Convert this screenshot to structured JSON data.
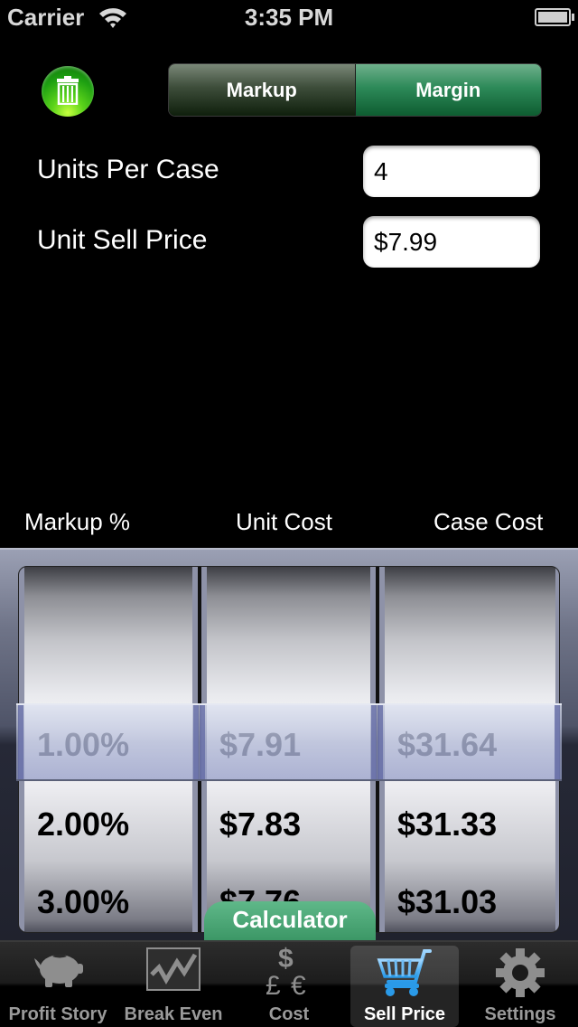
{
  "status_bar": {
    "carrier": "Carrier",
    "time": "3:35 PM",
    "wifi_icon": "wifi-icon",
    "battery_icon": "battery-icon"
  },
  "toolbar": {
    "trash_icon": "trash-icon",
    "trash_color": "#2fb516",
    "segments": [
      {
        "label": "Markup",
        "selected": false
      },
      {
        "label": "Margin",
        "selected": true
      }
    ]
  },
  "form": {
    "units_per_case": {
      "label": "Units Per Case",
      "value": "4"
    },
    "unit_sell_price": {
      "label": "Unit Sell Price",
      "value": "$7.99"
    }
  },
  "picker": {
    "headers": [
      "Markup %",
      "Unit Cost",
      "Case Cost"
    ],
    "columns": [
      {
        "name": "markup",
        "rows": [
          "1.00%",
          "2.00%",
          "3.00%"
        ]
      },
      {
        "name": "unit-cost",
        "rows": [
          "$7.91",
          "$7.83",
          "$7.76"
        ]
      },
      {
        "name": "case-cost",
        "rows": [
          "$31.64",
          "$31.33",
          "$31.03"
        ]
      }
    ],
    "selected_index": 0
  },
  "calculator_tab": {
    "label": "Calculator",
    "color": "#4aa676"
  },
  "tab_bar": {
    "items": [
      {
        "label": "Profit Story",
        "icon": "piggy-bank-icon",
        "active": false
      },
      {
        "label": "Break Even",
        "icon": "chart-line-icon",
        "active": false
      },
      {
        "label": "Cost",
        "icon": "currency-icon",
        "active": false,
        "glyphs": [
          "$",
          "£",
          "€"
        ]
      },
      {
        "label": "Sell Price",
        "icon": "shopping-cart-icon",
        "active": true
      },
      {
        "label": "Settings",
        "icon": "gear-icon",
        "active": false
      }
    ],
    "active_color": "#3aa8f0"
  }
}
